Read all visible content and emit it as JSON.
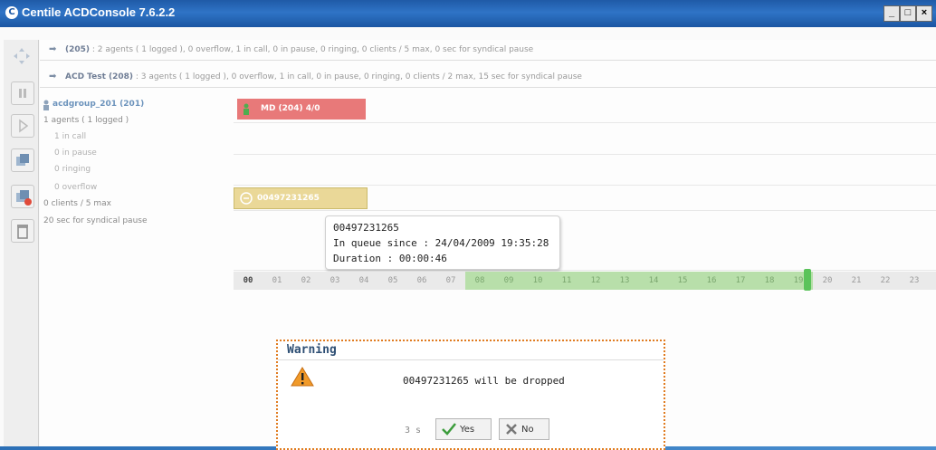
{
  "window": {
    "title": "Centile ACDConsole 7.6.2.2",
    "controls": [
      "_",
      "□",
      "×"
    ]
  },
  "queues": [
    {
      "name": "(205)",
      "text": ": 2 agents ( 1 logged ), 0 overflow, 1 in call, 0 in pause, 0 ringing, 0 clients / 5 max, 0 sec for syndical pause"
    },
    {
      "name": "ACD Test (208)",
      "text": ": 3 agents ( 1 logged ), 0 overflow, 1 in call, 0 in pause, 0 ringing, 0 clients / 2 max, 15 sec for syndical pause"
    }
  ],
  "group": {
    "name": "acdgroup_201 (201)",
    "agents": "1 agents ( 1 logged )",
    "in_call": "1 in call",
    "in_pause": "0 in pause",
    "ringing": "0 ringing",
    "overflow": "0 overflow",
    "clients": "0 clients / 5 max",
    "pause": "20 sec for syndical pause"
  },
  "agent_chip": {
    "label": "MD (204) 4/0",
    "color": "#e87979"
  },
  "queue_chip": {
    "label": "00497231265"
  },
  "tooltip": {
    "number": "00497231265",
    "since": "In queue since : 24/04/2009 19:35:28",
    "duration": "Duration : 00:00:46"
  },
  "timeline": {
    "hours": [
      "00",
      "01",
      "02",
      "03",
      "04",
      "05",
      "06",
      "07",
      "08",
      "09",
      "10",
      "11",
      "12",
      "13",
      "14",
      "15",
      "16",
      "17",
      "18",
      "19",
      "20",
      "21",
      "22",
      "23"
    ],
    "active_from": 8,
    "active_to": 19,
    "accent": "#b8dfaa"
  },
  "dialog": {
    "title": "Warning",
    "message": "00497231265 will be dropped",
    "countdown": "3 s",
    "yes_label": "Yes",
    "no_label": "No",
    "border_color": "#e07b1f"
  }
}
